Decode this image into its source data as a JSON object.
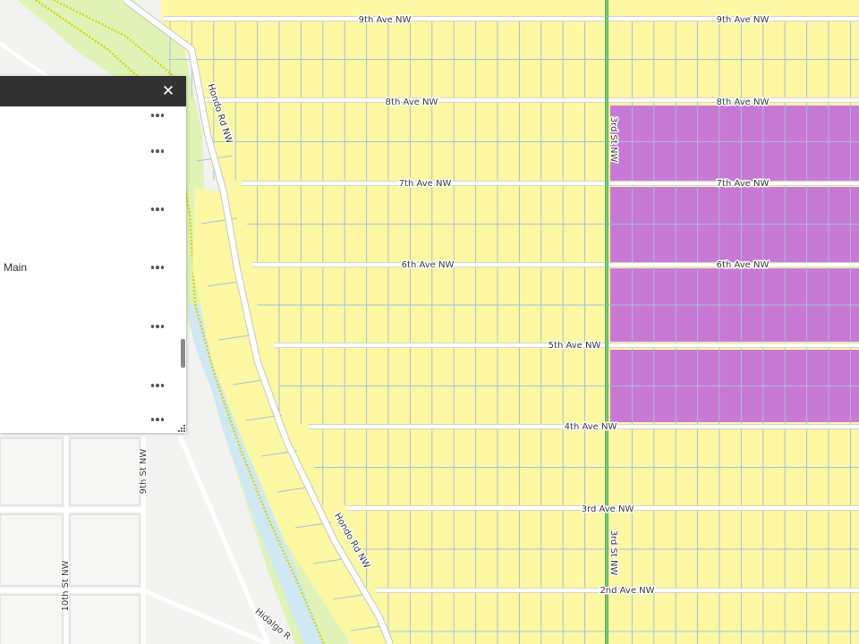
{
  "map": {
    "colors": {
      "background": "#f2f2f0",
      "residential_zone": "#fbf7a2",
      "commercial_zone": "#c879d6",
      "parcel_line": "#a9bfd9",
      "street": "#ffffff",
      "street_casing": "#c6c6c6",
      "river": "#cfe8f3",
      "riparian": "#d8f2a8",
      "trail": "#d2d400",
      "arterial": "#5fae5a"
    },
    "street_labels": {
      "ave_9_left": "9th Ave NW",
      "ave_9_right": "9th Ave NW",
      "ave_8_left": "8th Ave NW",
      "ave_8_right": "8th Ave NW",
      "ave_7_left": "7th Ave NW",
      "ave_7_right": "7th Ave NW",
      "ave_6_left": "6th Ave NW",
      "ave_6_right": "6th Ave NW",
      "ave_5": "5th Ave NW",
      "ave_4": "4th Ave NW",
      "ave_3": "3rd Ave NW",
      "ave_2": "2nd Ave NW",
      "st_3_north": "3rd St NW",
      "st_3_south": "3rd St NW",
      "st_9": "9th St NW",
      "st_10": "10th St NW",
      "hondo_north": "Hondo Rd NW",
      "hondo_south": "Hondo Rd NW",
      "hidalgo": "Hidalgo R"
    }
  },
  "panel": {
    "close_icon": "close-icon",
    "visible_label": "Main",
    "more_icon": "more-options-icon"
  }
}
